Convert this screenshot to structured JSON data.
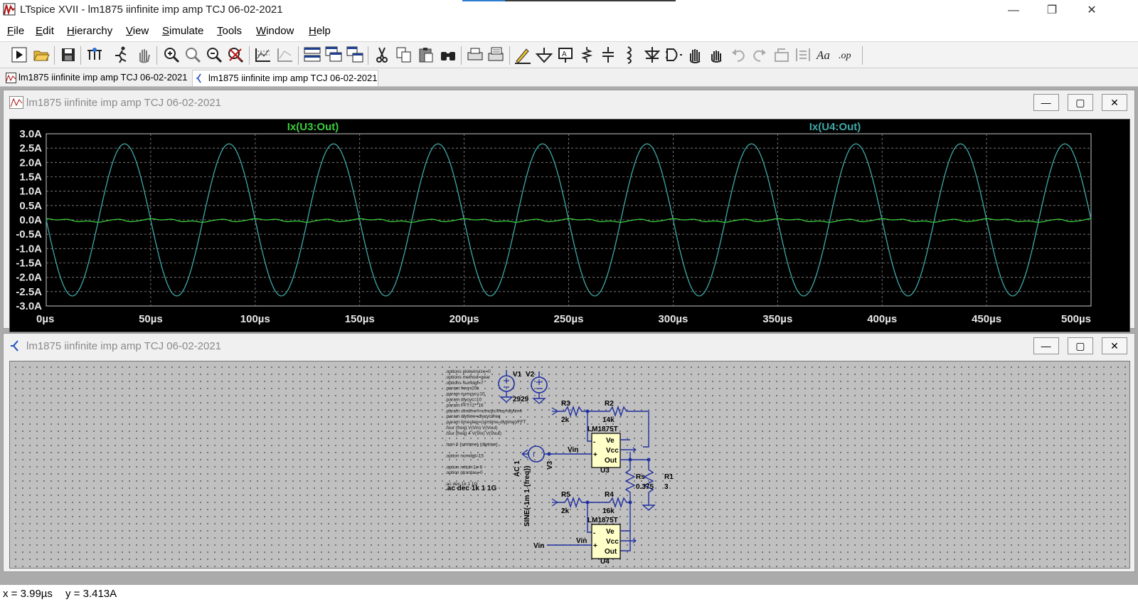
{
  "window": {
    "title": "LTspice XVII - lm1875 iinfinite imp amp TCJ 06-02-2021",
    "minimize": "—",
    "restore": "❐",
    "close": "✕"
  },
  "menu": [
    {
      "label": "File"
    },
    {
      "label": "Edit"
    },
    {
      "label": "Hierarchy"
    },
    {
      "label": "View"
    },
    {
      "label": "Simulate"
    },
    {
      "label": "Tools"
    },
    {
      "label": "Window"
    },
    {
      "label": "Help"
    }
  ],
  "tabs": [
    {
      "label": "lm1875 iinfinite imp amp TCJ 06-02-2021",
      "icon": "waveform-icon",
      "active": false
    },
    {
      "label": "lm1875 iinfinite imp amp TCJ 06-02-2021",
      "icon": "schematic-icon",
      "active": true
    }
  ],
  "waveform_window": {
    "title": "lm1875 iinfinite imp amp TCJ 06-02-2021",
    "buttons": {
      "min": "—",
      "max": "▢",
      "close": "✕"
    }
  },
  "schematic_window": {
    "title": "lm1875 iinfinite imp amp TCJ 06-02-2021",
    "buttons": {
      "min": "—",
      "max": "▢",
      "close": "✕"
    }
  },
  "chart_data": {
    "type": "line",
    "x_ticks": [
      "0µs",
      "50µs",
      "100µs",
      "150µs",
      "200µs",
      "250µs",
      "300µs",
      "350µs",
      "400µs",
      "450µs",
      "500µs"
    ],
    "y_ticks": [
      "3.0A",
      "2.5A",
      "2.0A",
      "1.5A",
      "1.0A",
      "0.5A",
      "0.0A",
      "-0.5A",
      "-1.0A",
      "-1.5A",
      "-2.0A",
      "-2.5A",
      "-3.0A"
    ],
    "xlim": [
      0,
      500
    ],
    "ylim": [
      -3.0,
      3.0
    ],
    "x_unit": "µs",
    "y_unit": "A",
    "grid": true,
    "series": [
      {
        "name": "Ix(U3:Out)",
        "color": "#3ccd3c",
        "shape": "residual",
        "amplitude": 0.1,
        "period_us": 50
      },
      {
        "name": "Ix(U4:Out)",
        "color": "#3fa8a8",
        "shape": "sine",
        "amplitude": 2.65,
        "period_us": 50,
        "phase_sign": -1
      }
    ]
  },
  "schematic": {
    "directives": [
      ".options plotwinsize=0",
      ".options method=gear",
      ".options numdgt=7",
      ".param freq=20k",
      ".param numcyc=10",
      ".param dlycyc=10",
      ".param FFT=2**16",
      ".param simtime=numcyc/freq+dlytime",
      ".param dlytime=dlycyc/freq",
      ".param timestep=(simtime-dlytime)/FFT",
      ".four {freq} V(Vin) V(Vout)",
      ".four {freq} 4 V(Vin) V(Vout)",
      ";",
      ".tran 0 {simtime} {dlytime}",
      "",
      ".option numdgt=15",
      "",
      ".option reltol=1e-6",
      ".option ptrantau=0",
      "",
      ";ac dec 1k 1 1G"
    ],
    "ac_directive": ".ac dec 1k 1 1G",
    "components": {
      "V1": "V1",
      "V2": "V2",
      "v12_value": "2929",
      "R3": "R3",
      "R3_val": "2k",
      "R2": "R2",
      "R2_val": "14k",
      "R5": "R5",
      "R5_val": "2k",
      "R4": "R4",
      "R4_val": "16k",
      "Rs": "Rs",
      "Rs_val": "0.375",
      "R1": "R1",
      "R1_val": "3",
      "U3": "U3",
      "U4": "U4",
      "opamp_model": "LM1875T",
      "V3": "V3",
      "v3_ac": "AC 1",
      "v3_sine": "SINE(-1m 1 {freq})",
      "vin1": "Vin",
      "vin2": "Vin",
      "vin3": "Vin",
      "pin_ve": "Ve",
      "pin_vcc": "Vcc",
      "pin_out": "Out",
      "pin_minus": "-",
      "pin_plus": "+"
    }
  },
  "status": {
    "x": "x = 3.99µs",
    "y": "y = 3.413A"
  }
}
